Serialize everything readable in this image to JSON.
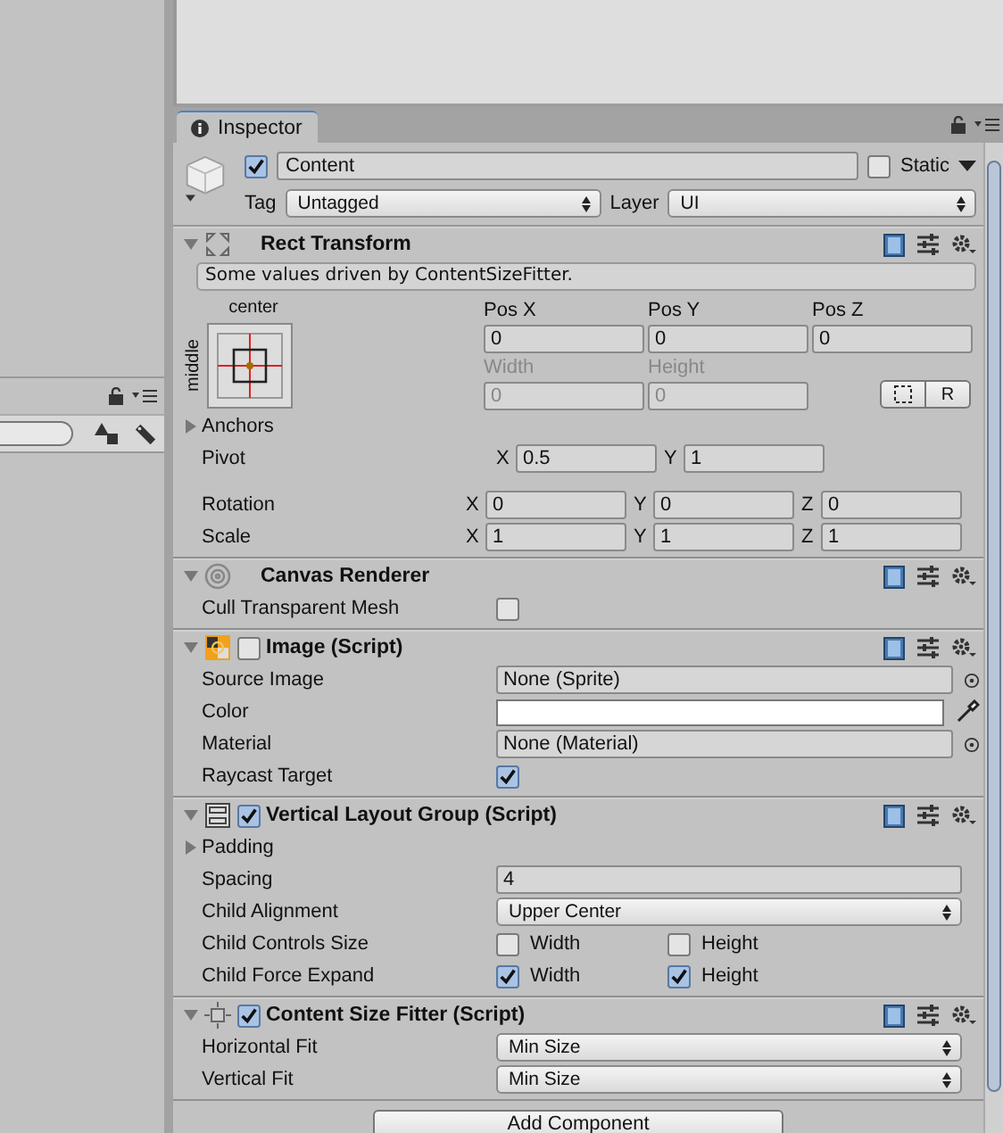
{
  "inspector": {
    "tab": {
      "label": "Inspector",
      "selected": true
    },
    "object": {
      "active": true,
      "name": "Content",
      "static": false,
      "static_label": "Static",
      "tag_label": "Tag",
      "tag": "Untagged",
      "layer_label": "Layer",
      "layer": "UI"
    },
    "components": [
      {
        "kind": "rect",
        "title": "Rect Transform",
        "expanded": true,
        "note": "Some values driven by ContentSizeFitter.",
        "anchor_horizontal": "center",
        "anchor_vertical": "middle",
        "position_fields": [
          {
            "label": "Pos X",
            "value": "0",
            "disabled": false
          },
          {
            "label": "Pos Y",
            "value": "0",
            "disabled": false
          },
          {
            "label": "Pos Z",
            "value": "0",
            "disabled": false
          },
          {
            "label": "Width",
            "value": "0",
            "disabled": true
          },
          {
            "label": "Height",
            "value": "0",
            "disabled": true
          }
        ],
        "mode_buttons": [
          {
            "kind": "blueprint"
          },
          {
            "kind": "raw",
            "label": "R"
          }
        ],
        "rows": [
          {
            "kind": "foldout",
            "label": "Anchors",
            "expanded": false
          },
          {
            "kind": "vector",
            "label": "Pivot",
            "values": [
              {
                "axis": "X",
                "value": "0.5"
              },
              {
                "axis": "Y",
                "value": "1"
              }
            ]
          },
          {
            "kind": "vector",
            "label": "Rotation",
            "values": [
              {
                "axis": "X",
                "value": "0"
              },
              {
                "axis": "Y",
                "value": "0"
              },
              {
                "axis": "Z",
                "value": "0"
              }
            ]
          },
          {
            "kind": "vector",
            "label": "Scale",
            "values": [
              {
                "axis": "X",
                "value": "1"
              },
              {
                "axis": "Y",
                "value": "1"
              },
              {
                "axis": "Z",
                "value": "1"
              }
            ]
          }
        ]
      },
      {
        "kind": "canvas",
        "title": "Canvas Renderer",
        "expanded": true,
        "rows": [
          {
            "kind": "toggle",
            "label": "Cull Transparent Mesh",
            "checked": false
          }
        ]
      },
      {
        "kind": "image",
        "title": "Image (Script)",
        "expanded": true,
        "enabled": false,
        "rows": [
          {
            "kind": "object",
            "label": "Source Image",
            "value": "None (Sprite)"
          },
          {
            "kind": "color",
            "label": "Color",
            "color": "#ffffff"
          },
          {
            "kind": "object",
            "label": "Material",
            "value": "None (Material)"
          },
          {
            "kind": "toggle",
            "label": "Raycast Target",
            "checked": true
          }
        ]
      },
      {
        "kind": "layout",
        "title": "Vertical Layout Group (Script)",
        "expanded": true,
        "enabled": true,
        "rows": [
          {
            "kind": "foldout",
            "label": "Padding",
            "expanded": false
          },
          {
            "kind": "text",
            "label": "Spacing",
            "value": "4"
          },
          {
            "kind": "dropdown",
            "label": "Child Alignment",
            "value": "Upper Center"
          },
          {
            "kind": "toggles",
            "label": "Child Controls Size",
            "items": [
              {
                "label": "Width",
                "checked": false
              },
              {
                "label": "Height",
                "checked": false
              }
            ]
          },
          {
            "kind": "toggles",
            "label": "Child Force Expand",
            "items": [
              {
                "label": "Width",
                "checked": true
              },
              {
                "label": "Height",
                "checked": true
              }
            ]
          }
        ]
      },
      {
        "kind": "fitter",
        "title": "Content Size Fitter (Script)",
        "expanded": true,
        "enabled": true,
        "rows": [
          {
            "kind": "dropdown",
            "label": "Horizontal Fit",
            "value": "Min Size"
          },
          {
            "kind": "dropdown",
            "label": "Vertical Fit",
            "value": "Min Size"
          }
        ]
      }
    ],
    "add_button": "Add Component"
  }
}
